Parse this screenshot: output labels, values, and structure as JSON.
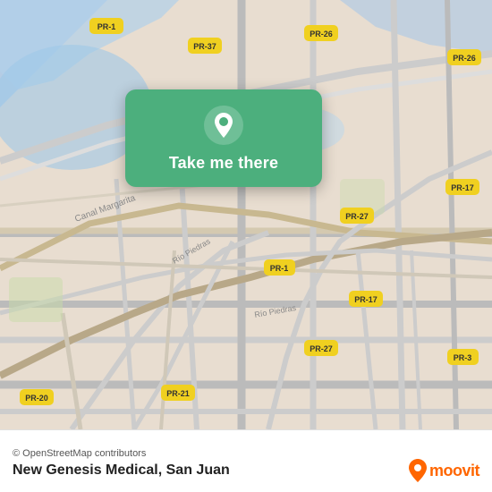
{
  "map": {
    "background_color": "#e8e0d8",
    "attribution": "© OpenStreetMap contributors",
    "place_name": "New Genesis Medical, San Juan"
  },
  "tooltip": {
    "label": "Take me there",
    "bg_color": "#4caf7d"
  },
  "moovit": {
    "logo_text": "moovit"
  },
  "roads": [
    {
      "label": "PR-1"
    },
    {
      "label": "PR-37"
    },
    {
      "label": "PR-26"
    },
    {
      "label": "PR-17"
    },
    {
      "label": "PR-27"
    },
    {
      "label": "PR-20"
    },
    {
      "label": "PR-21"
    },
    {
      "label": "PR-3"
    }
  ]
}
